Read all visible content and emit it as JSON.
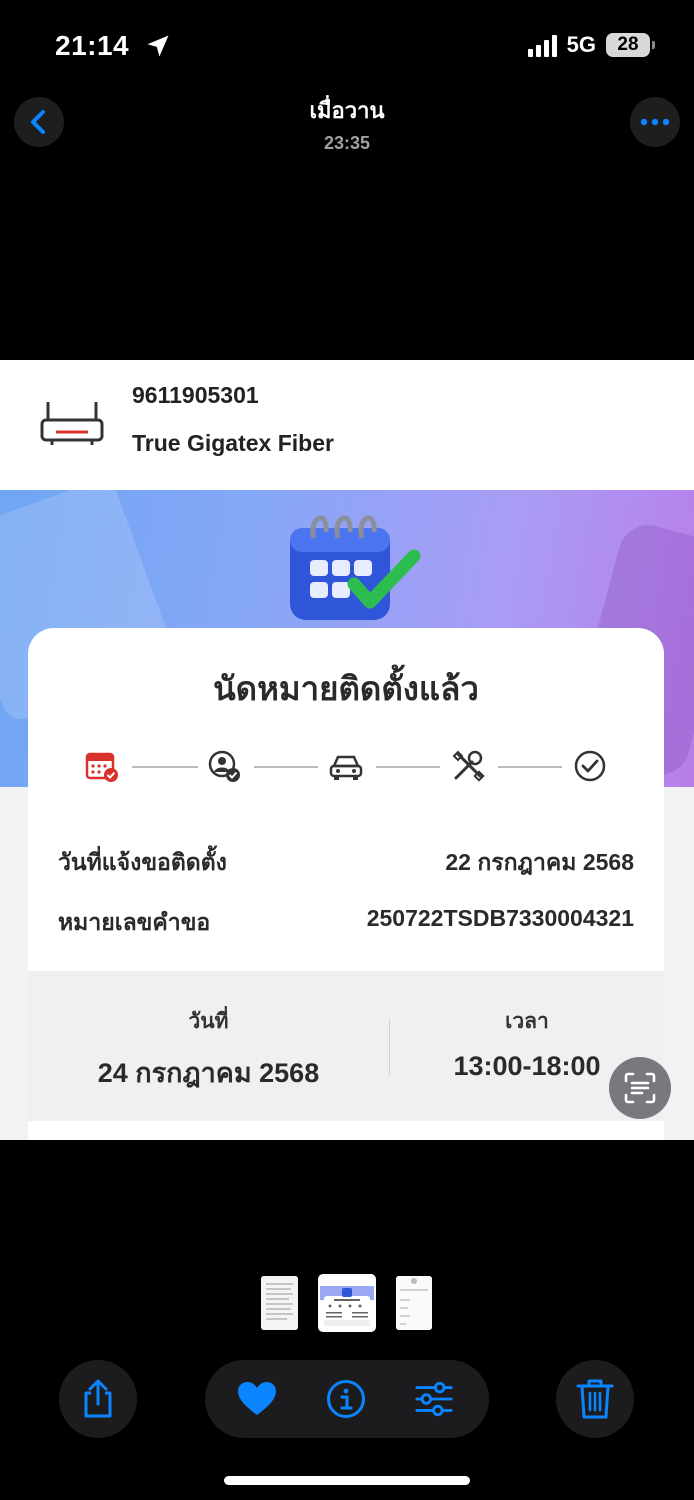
{
  "status_bar": {
    "time": "21:14",
    "network": "5G",
    "battery": "28"
  },
  "header": {
    "title": "เมื่อวาน",
    "subtitle": "23:35"
  },
  "photo": {
    "product": {
      "number": "9611905301",
      "name": "True Gigatex Fiber"
    },
    "card": {
      "title": "นัดหมายติดตั้งแล้ว",
      "steps": [
        "calendar-check-icon",
        "user-check-icon",
        "car-icon",
        "tools-icon",
        "check-circle-icon"
      ],
      "info": [
        {
          "label": "วันที่แจ้งขอติดตั้ง",
          "value": "22 กรกฎาคม 2568"
        },
        {
          "label": "หมายเลขคำขอ",
          "value": "250722TSDB7330004321"
        }
      ],
      "appointment": {
        "date_label": "วันที่",
        "date_value": "24 กรกฎาคม 2568",
        "time_label": "เวลา",
        "time_value": "13:00-18:00"
      }
    }
  },
  "colors": {
    "accent": "#0a84ff",
    "step_active": "#d9312b",
    "banner_start": "#6fa6f3",
    "banner_end": "#b97de8"
  },
  "toolbar": [
    "share-icon",
    "heart-icon",
    "info-icon",
    "adjust-icon",
    "trash-icon"
  ]
}
